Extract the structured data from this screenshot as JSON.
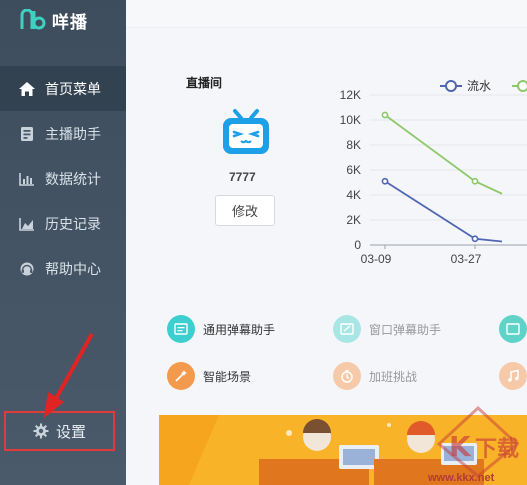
{
  "app": {
    "name": "咩播"
  },
  "sidebar": {
    "items": [
      {
        "label": "首页菜单",
        "icon": "home-icon",
        "active": true
      },
      {
        "label": "主播助手",
        "icon": "assistant-icon",
        "active": false
      },
      {
        "label": "数据统计",
        "icon": "bar-chart-icon",
        "active": false
      },
      {
        "label": "历史记录",
        "icon": "area-chart-icon",
        "active": false
      },
      {
        "label": "帮助中心",
        "icon": "headset-icon",
        "active": false
      }
    ],
    "settings_label": "设置"
  },
  "live": {
    "title": "直播间",
    "uid": "7777",
    "edit_label": "修改"
  },
  "chart_data": {
    "type": "line",
    "x": [
      "03-09",
      "03-27"
    ],
    "ylim": [
      0,
      12000
    ],
    "yticks": [
      "0",
      "2K",
      "4K",
      "6K",
      "8K",
      "10K",
      "12K"
    ],
    "series": [
      {
        "name": "流水",
        "color": "#5066b4",
        "points": [
          [
            0,
            5100
          ],
          [
            1,
            500
          ],
          [
            1.3,
            280
          ]
        ]
      },
      {
        "name": "",
        "color": "#8ec86a",
        "points": [
          [
            0,
            10400
          ],
          [
            1,
            5100
          ],
          [
            1.3,
            4100
          ]
        ]
      }
    ],
    "legend": "top-right"
  },
  "tools": [
    {
      "label": "通用弹幕助手",
      "icon": "danmaku-icon",
      "color": "#3dcfcf",
      "dim": false
    },
    {
      "label": "窗口弹幕助手",
      "icon": "window-danmaku-icon",
      "color": "#a8e6e6",
      "dim": true
    },
    {
      "label": "智能场景",
      "icon": "magic-wand-icon",
      "color": "#f39a4c",
      "dim": false
    },
    {
      "label": "加班挑战",
      "icon": "timer-icon",
      "color": "#f6c9a8",
      "dim": true
    }
  ],
  "watermark": {
    "text": "www.kkx.net"
  }
}
